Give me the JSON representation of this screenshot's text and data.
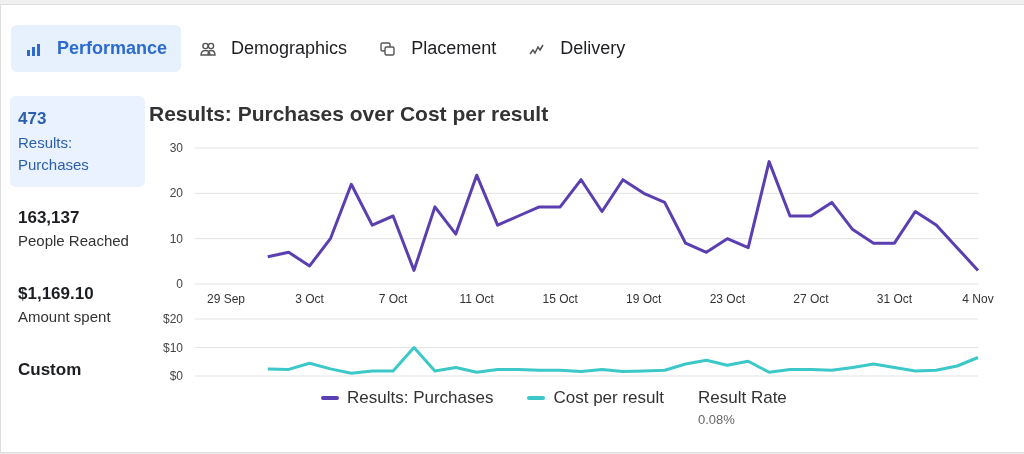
{
  "tabs": [
    {
      "label": "Performance",
      "selected": true
    },
    {
      "label": "Demographics",
      "selected": false
    },
    {
      "label": "Placement",
      "selected": false
    },
    {
      "label": "Delivery",
      "selected": false
    }
  ],
  "metrics": [
    {
      "value": "473",
      "label": "Results: Purchases",
      "selected": true
    },
    {
      "value": "163,137",
      "label": "People Reached",
      "selected": false
    },
    {
      "value": "$1,169.10",
      "label": "Amount spent",
      "selected": false
    },
    {
      "value": "Custom",
      "selected": false
    }
  ],
  "chart_title": "Results: Purchases over Cost per result",
  "purchases_chart": {
    "chart_data": {
      "type": "line",
      "categories": [
        "29 Sep",
        null,
        null,
        null,
        "3 Oct",
        null,
        null,
        null,
        "7 Oct",
        null,
        null,
        null,
        "11 Oct",
        null,
        null,
        null,
        "15 Oct",
        null,
        null,
        null,
        "19 Oct",
        null,
        null,
        null,
        "23 Oct",
        null,
        null,
        null,
        "27 Oct",
        null,
        null,
        null,
        "31 Oct",
        null,
        null,
        null,
        "4 Nov"
      ],
      "series": [
        {
          "name": "Results: Purchases",
          "color": "#5b3fb0",
          "values": [
            null,
            null,
            6,
            7,
            4,
            10,
            22,
            13,
            15,
            3,
            17,
            11,
            24,
            13,
            15,
            17,
            17,
            23,
            16,
            23,
            20,
            18,
            9,
            7,
            10,
            8,
            27,
            15,
            15,
            18,
            12,
            9,
            9,
            16,
            13,
            8,
            3
          ]
        }
      ],
      "ylim": [
        0,
        30
      ],
      "yticks": [
        0,
        10,
        20,
        30
      ]
    }
  },
  "cost_chart": {
    "chart_data": {
      "type": "line",
      "categories": [
        null,
        null,
        null,
        null,
        null,
        null,
        null,
        null,
        null,
        null,
        null,
        null,
        null,
        null,
        null,
        null,
        null,
        null,
        null,
        null,
        null,
        null,
        null,
        null,
        null,
        null,
        null,
        null,
        null,
        null,
        null,
        null,
        null,
        null,
        null,
        null,
        null
      ],
      "series": [
        {
          "name": "Cost per result",
          "color": "#3cc8c8",
          "values": [
            null,
            null,
            2.5,
            2.3,
            4.5,
            2.5,
            1,
            1.8,
            1.8,
            10,
            1.8,
            3,
            1.3,
            2.3,
            2.3,
            2,
            2,
            1.6,
            2.3,
            1.6,
            1.8,
            2,
            4.2,
            5.5,
            3.8,
            5.2,
            1.3,
            2.3,
            2.3,
            2,
            3,
            4.2,
            3,
            1.8,
            2,
            3.5,
            6.5
          ]
        }
      ],
      "ylim": [
        0,
        20
      ],
      "yticks": [
        {
          "value": 0,
          "label": "$0"
        },
        {
          "value": 10,
          "label": "$10"
        },
        {
          "value": 20,
          "label": "$20"
        }
      ]
    }
  },
  "result_rate": {
    "label": "Result Rate",
    "value": "0.08%"
  }
}
